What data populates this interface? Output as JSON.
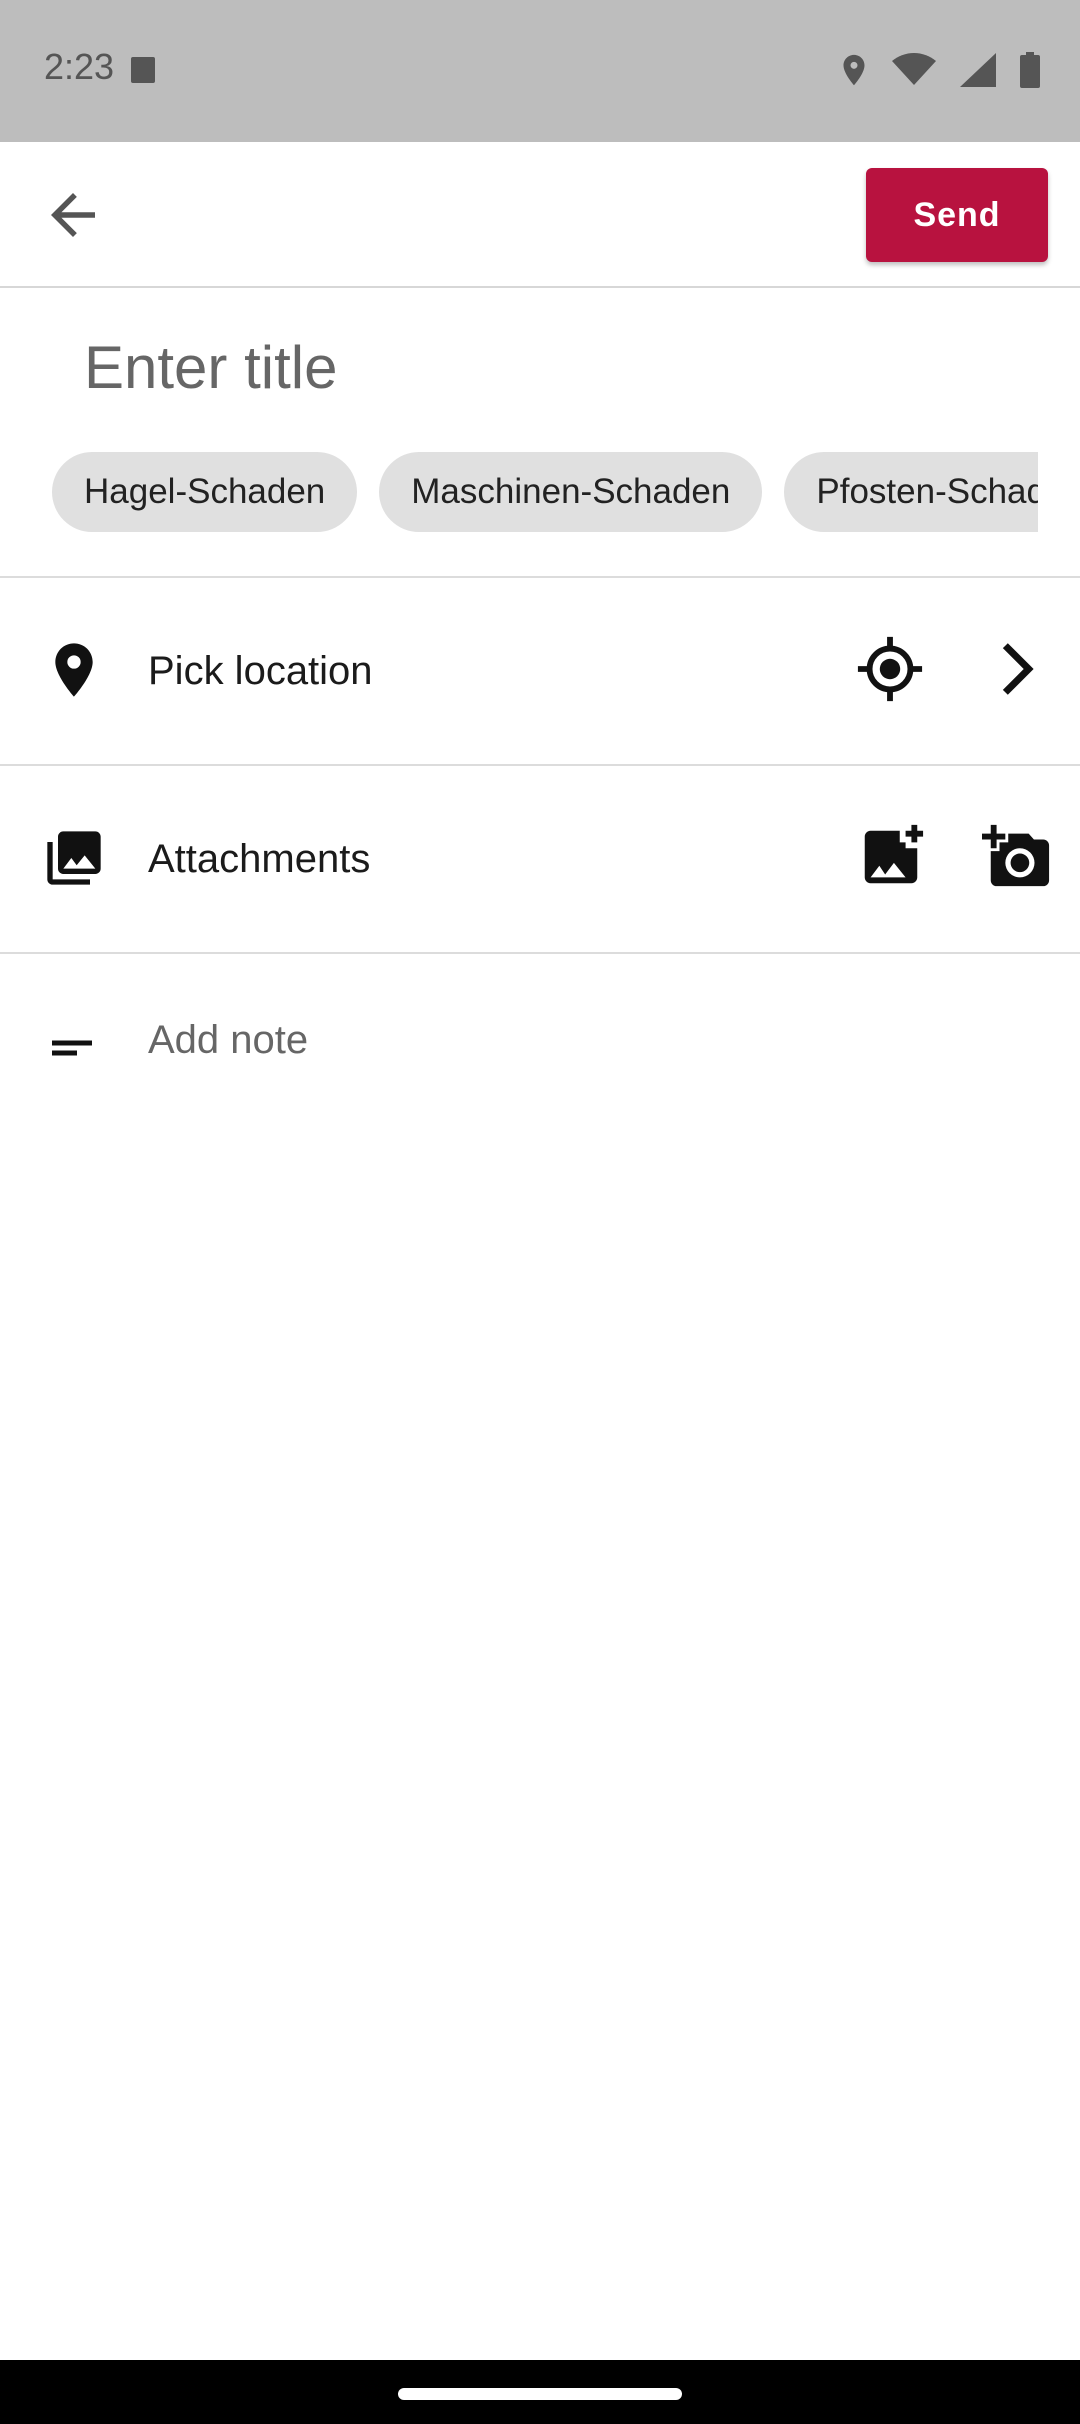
{
  "status_bar": {
    "time": "2:23",
    "icons": [
      "keyboard-a-icon",
      "location-icon",
      "wifi-icon",
      "signal-icon",
      "battery-icon"
    ]
  },
  "app_bar": {
    "back_icon": "arrow-back-icon",
    "send_label": "Send",
    "send_color": "#b8123f"
  },
  "title_field": {
    "placeholder": "Enter title",
    "value": ""
  },
  "tags": [
    "Hagel-Schaden",
    "Maschinen-Schaden",
    "Pfosten-Schaden"
  ],
  "location": {
    "label": "Pick location",
    "icon": "location-pin-icon",
    "actions": [
      "my-location-icon",
      "chevron-right-icon"
    ]
  },
  "attachments": {
    "label": "Attachments",
    "icon": "photo-library-icon",
    "actions": [
      "add-photo-icon",
      "add-camera-icon"
    ]
  },
  "note": {
    "placeholder": "Add note",
    "icon": "short-text-icon"
  }
}
